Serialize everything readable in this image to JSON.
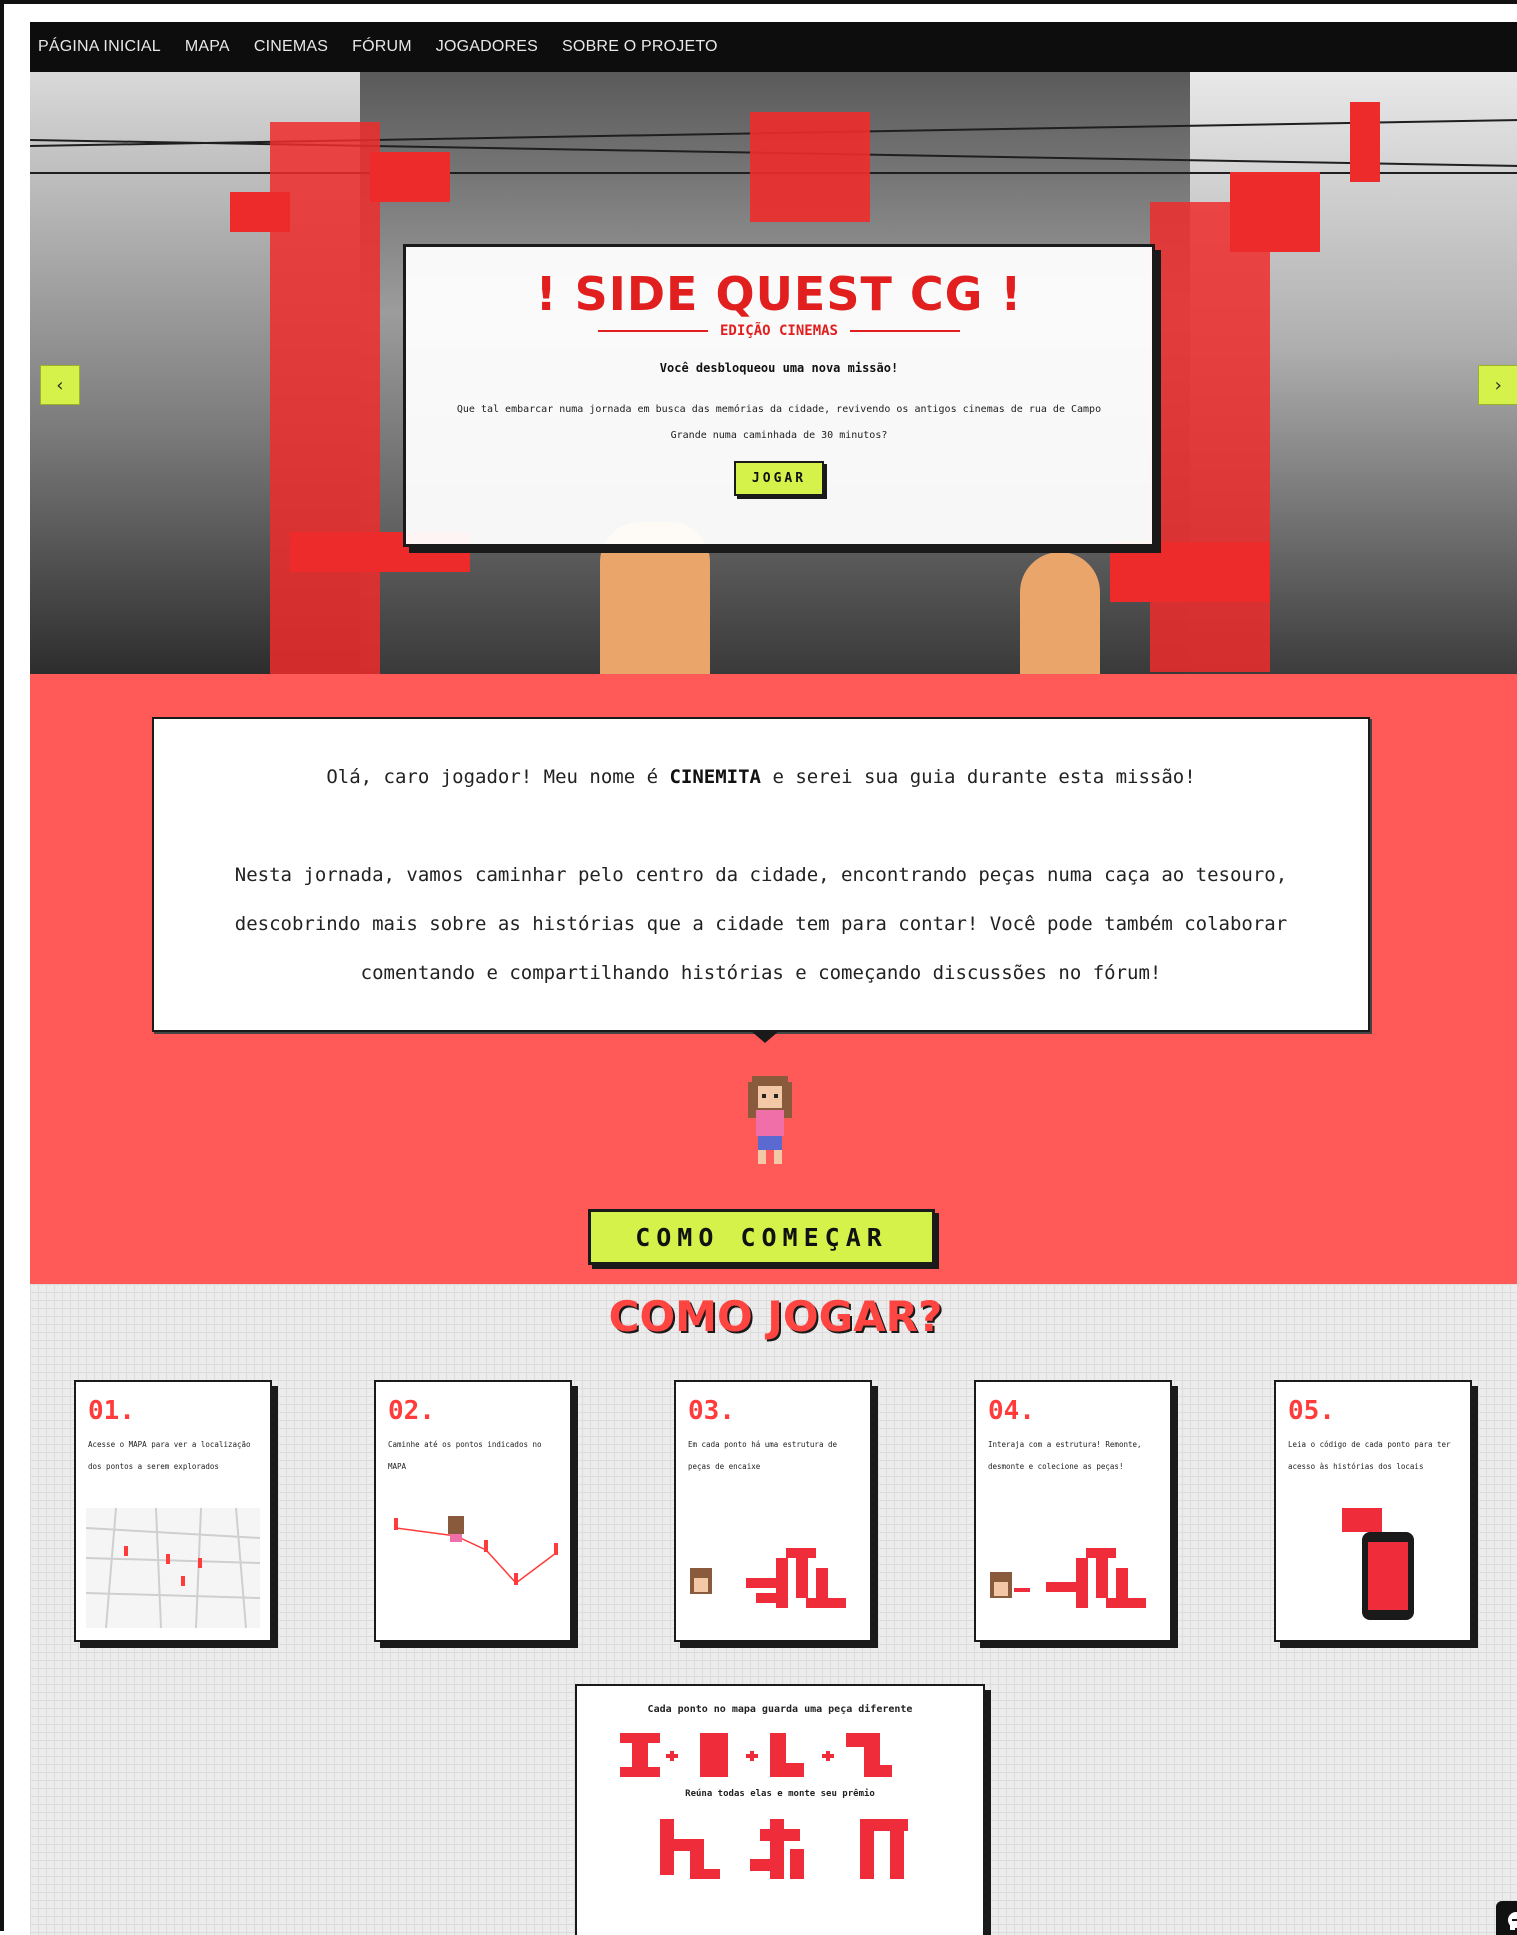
{
  "nav": {
    "items": [
      "PÁGINA INICIAL",
      "MAPA",
      "CINEMAS",
      "FÓRUM",
      "JOGADORES",
      "SOBRE O PROJETO"
    ]
  },
  "hero": {
    "title": "! SIDE QUEST CG !",
    "subtitle": "EDIÇÃO CINEMAS",
    "unlock": "Você desbloqueou uma nova missão!",
    "description": "Que tal embarcar numa jornada em busca das memórias da cidade, revivendo os antigos cinemas de rua de Campo Grande numa caminhada de 30 minutos?",
    "play_label": "JOGAR",
    "prev_icon": "chevron-left-icon",
    "next_icon": "chevron-right-icon"
  },
  "intro": {
    "greeting_pre": "Olá, caro jogador! Meu nome é ",
    "guide_name": "CINEMITA",
    "greeting_post": " e serei sua guia durante esta missão!",
    "line2": "Nesta jornada, vamos caminhar pelo centro da cidade, encontrando peças numa caça ao tesouro,",
    "line3": "descobrindo mais sobre as histórias que a cidade tem para contar! Você pode também colaborar",
    "line4": "comentando e compartilhando histórias e começando discussões no fórum!",
    "start_label": "COMO COMEÇAR"
  },
  "howto": {
    "title": "COMO JOGAR?",
    "steps": [
      {
        "num": "01.",
        "text": "Acesse o MAPA para ver a localização dos pontos a serem explorados"
      },
      {
        "num": "02.",
        "text": "Caminhe até os pontos indicados no MAPA"
      },
      {
        "num": "03.",
        "text": "Em cada ponto há uma estrutura de peças de encaixe"
      },
      {
        "num": "04.",
        "text": "Interaja com a estrutura! Remonte, desmonte e colecione as peças!"
      },
      {
        "num": "05.",
        "text": "Leia o código de cada ponto para ter acesso às histórias dos locais"
      }
    ],
    "pieces_head": "Cada ponto no mapa guarda uma peça diferente",
    "pieces_mid": "Reúna todas elas e monte seu prêmio"
  },
  "colors": {
    "accent_red": "#ff5a58",
    "title_red": "#e11f1f",
    "button_lime": "#d5f24a",
    "nav_bg": "#0d0d0d"
  },
  "icons": {
    "chat": "chat-bubble-icon"
  }
}
